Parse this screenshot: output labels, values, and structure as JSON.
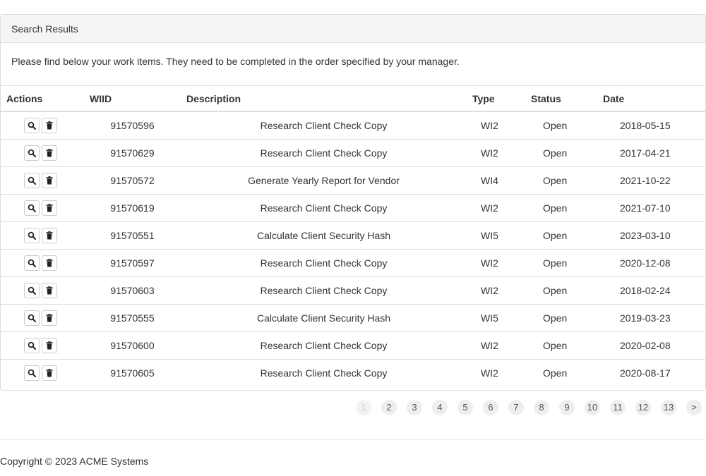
{
  "panel": {
    "heading": "Search Results",
    "body_text": "Please find below your work items. They need to be completed in the order specified by your manager."
  },
  "table": {
    "headers": {
      "actions": "Actions",
      "wiid": "WIID",
      "description": "Description",
      "type": "Type",
      "status": "Status",
      "date": "Date"
    },
    "rows": [
      {
        "wiid": "91570596",
        "description": "Research Client Check Copy",
        "type": "WI2",
        "status": "Open",
        "date": "2018-05-15"
      },
      {
        "wiid": "91570629",
        "description": "Research Client Check Copy",
        "type": "WI2",
        "status": "Open",
        "date": "2017-04-21"
      },
      {
        "wiid": "91570572",
        "description": "Generate Yearly Report for Vendor",
        "type": "WI4",
        "status": "Open",
        "date": "2021-10-22"
      },
      {
        "wiid": "91570619",
        "description": "Research Client Check Copy",
        "type": "WI2",
        "status": "Open",
        "date": "2021-07-10"
      },
      {
        "wiid": "91570551",
        "description": "Calculate Client Security Hash",
        "type": "WI5",
        "status": "Open",
        "date": "2023-03-10"
      },
      {
        "wiid": "91570597",
        "description": "Research Client Check Copy",
        "type": "WI2",
        "status": "Open",
        "date": "2020-12-08"
      },
      {
        "wiid": "91570603",
        "description": "Research Client Check Copy",
        "type": "WI2",
        "status": "Open",
        "date": "2018-02-24"
      },
      {
        "wiid": "91570555",
        "description": "Calculate Client Security Hash",
        "type": "WI5",
        "status": "Open",
        "date": "2019-03-23"
      },
      {
        "wiid": "91570600",
        "description": "Research Client Check Copy",
        "type": "WI2",
        "status": "Open",
        "date": "2020-02-08"
      },
      {
        "wiid": "91570605",
        "description": "Research Client Check Copy",
        "type": "WI2",
        "status": "Open",
        "date": "2020-08-17"
      }
    ],
    "row_actions": [
      "search-icon",
      "trash-icon"
    ]
  },
  "pagination": {
    "pages": [
      "1",
      "2",
      "3",
      "4",
      "5",
      "6",
      "7",
      "8",
      "9",
      "10",
      "11",
      "12",
      "13"
    ],
    "active": "1",
    "next_label": ">"
  },
  "footer": {
    "copyright": "Copyright © 2023 ACME Systems"
  }
}
